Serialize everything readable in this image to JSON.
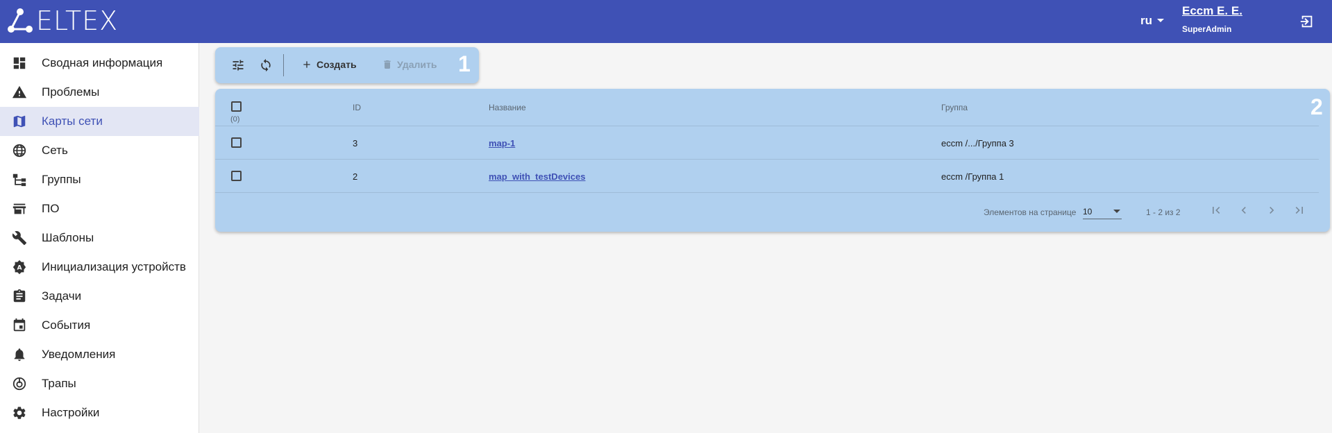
{
  "app": {
    "logo_text": "ELTEX"
  },
  "header": {
    "lang": "ru",
    "user_name": "Eccm E. E.",
    "user_role": "SuperAdmin"
  },
  "colors": {
    "header_bg": "#3f51b5",
    "panel_bg": "#b0d0ef",
    "active_item_bg": "#e3e6f4",
    "link": "#3f51b5"
  },
  "sidebar": {
    "items": [
      {
        "label": "Сводная информация",
        "icon": "dashboard-icon"
      },
      {
        "label": "Проблемы",
        "icon": "warning-icon"
      },
      {
        "label": "Карты сети",
        "icon": "map-icon",
        "active": true
      },
      {
        "label": "Сеть",
        "icon": "globe-icon"
      },
      {
        "label": "Группы",
        "icon": "tree-icon"
      },
      {
        "label": "ПО",
        "icon": "store-icon"
      },
      {
        "label": "Шаблоны",
        "icon": "wrench-icon"
      },
      {
        "label": "Инициализация устройств",
        "icon": "init-icon"
      },
      {
        "label": "Задачи",
        "icon": "clipboard-icon"
      },
      {
        "label": "События",
        "icon": "calendar-icon"
      },
      {
        "label": "Уведомления",
        "icon": "bell-icon"
      },
      {
        "label": "Трапы",
        "icon": "trap-icon"
      },
      {
        "label": "Настройки",
        "icon": "gear-icon"
      }
    ]
  },
  "toolbar": {
    "create_label": "Создать",
    "delete_label": "Удалить",
    "panel_number": "1"
  },
  "table": {
    "panel_number": "2",
    "headers": {
      "id": "ID",
      "name": "Название",
      "group": "Группа"
    },
    "selected_count": "(0)",
    "rows": [
      {
        "id": "3",
        "name": "map-1",
        "group": "eccm /.../Группа 3"
      },
      {
        "id": "2",
        "name": "map_with_testDevices",
        "group": "eccm /Группа 1"
      }
    ],
    "pager": {
      "per_page_label": "Элементов на странице",
      "per_page_value": "10",
      "range": "1 - 2 из 2"
    }
  }
}
